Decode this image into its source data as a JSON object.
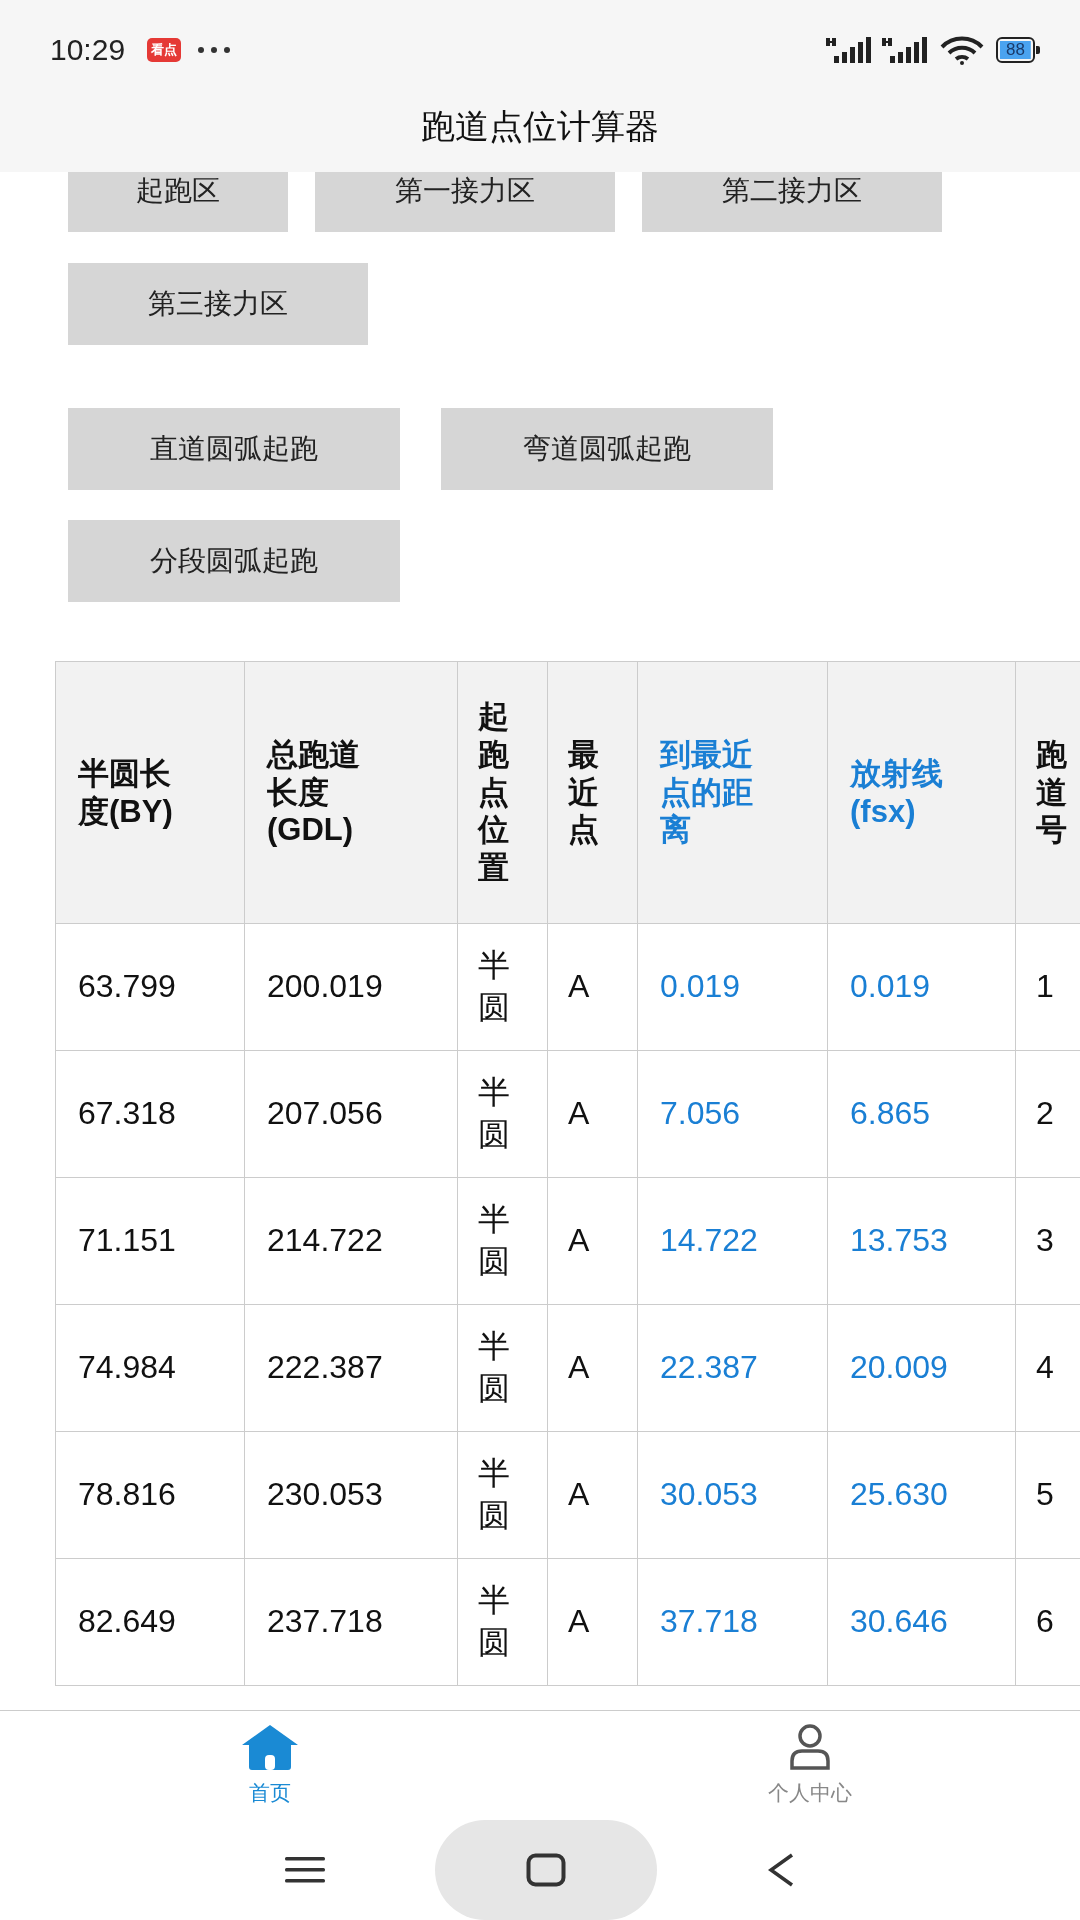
{
  "status_bar": {
    "time": "10:29",
    "app_badge": "看点",
    "battery": "88"
  },
  "header": {
    "title": "跑道点位计算器"
  },
  "zone_buttons": [
    "起跑区",
    "第一接力区",
    "第二接力区",
    "第三接力区"
  ],
  "start_buttons": [
    "直道圆弧起跑",
    "弯道圆弧起跑",
    "分段圆弧起跑"
  ],
  "table": {
    "columns": [
      {
        "label": "半圆长度(BY)",
        "kind": "plain"
      },
      {
        "label": "总跑道长度(GDL)",
        "kind": "plain"
      },
      {
        "label": "起跑点位置",
        "kind": "plain"
      },
      {
        "label": "最近点",
        "kind": "plain"
      },
      {
        "label": "到最近点的距离",
        "kind": "accent"
      },
      {
        "label": "放射线(fsx)",
        "kind": "accent"
      },
      {
        "label": "跑道号",
        "kind": "plain"
      }
    ],
    "rows": [
      [
        "63.799",
        "200.019",
        "半圆",
        "A",
        "0.019",
        "0.019",
        "1"
      ],
      [
        "67.318",
        "207.056",
        "半圆",
        "A",
        "7.056",
        "6.865",
        "2"
      ],
      [
        "71.151",
        "214.722",
        "半圆",
        "A",
        "14.722",
        "13.753",
        "3"
      ],
      [
        "74.984",
        "222.387",
        "半圆",
        "A",
        "22.387",
        "20.009",
        "4"
      ],
      [
        "78.816",
        "230.053",
        "半圆",
        "A",
        "30.053",
        "25.630",
        "5"
      ],
      [
        "82.649",
        "237.718",
        "半圆",
        "A",
        "37.718",
        "30.646",
        "6"
      ]
    ]
  },
  "tabs": [
    {
      "label": "首页",
      "selected": true
    },
    {
      "label": "个人中心",
      "selected": false
    }
  ]
}
